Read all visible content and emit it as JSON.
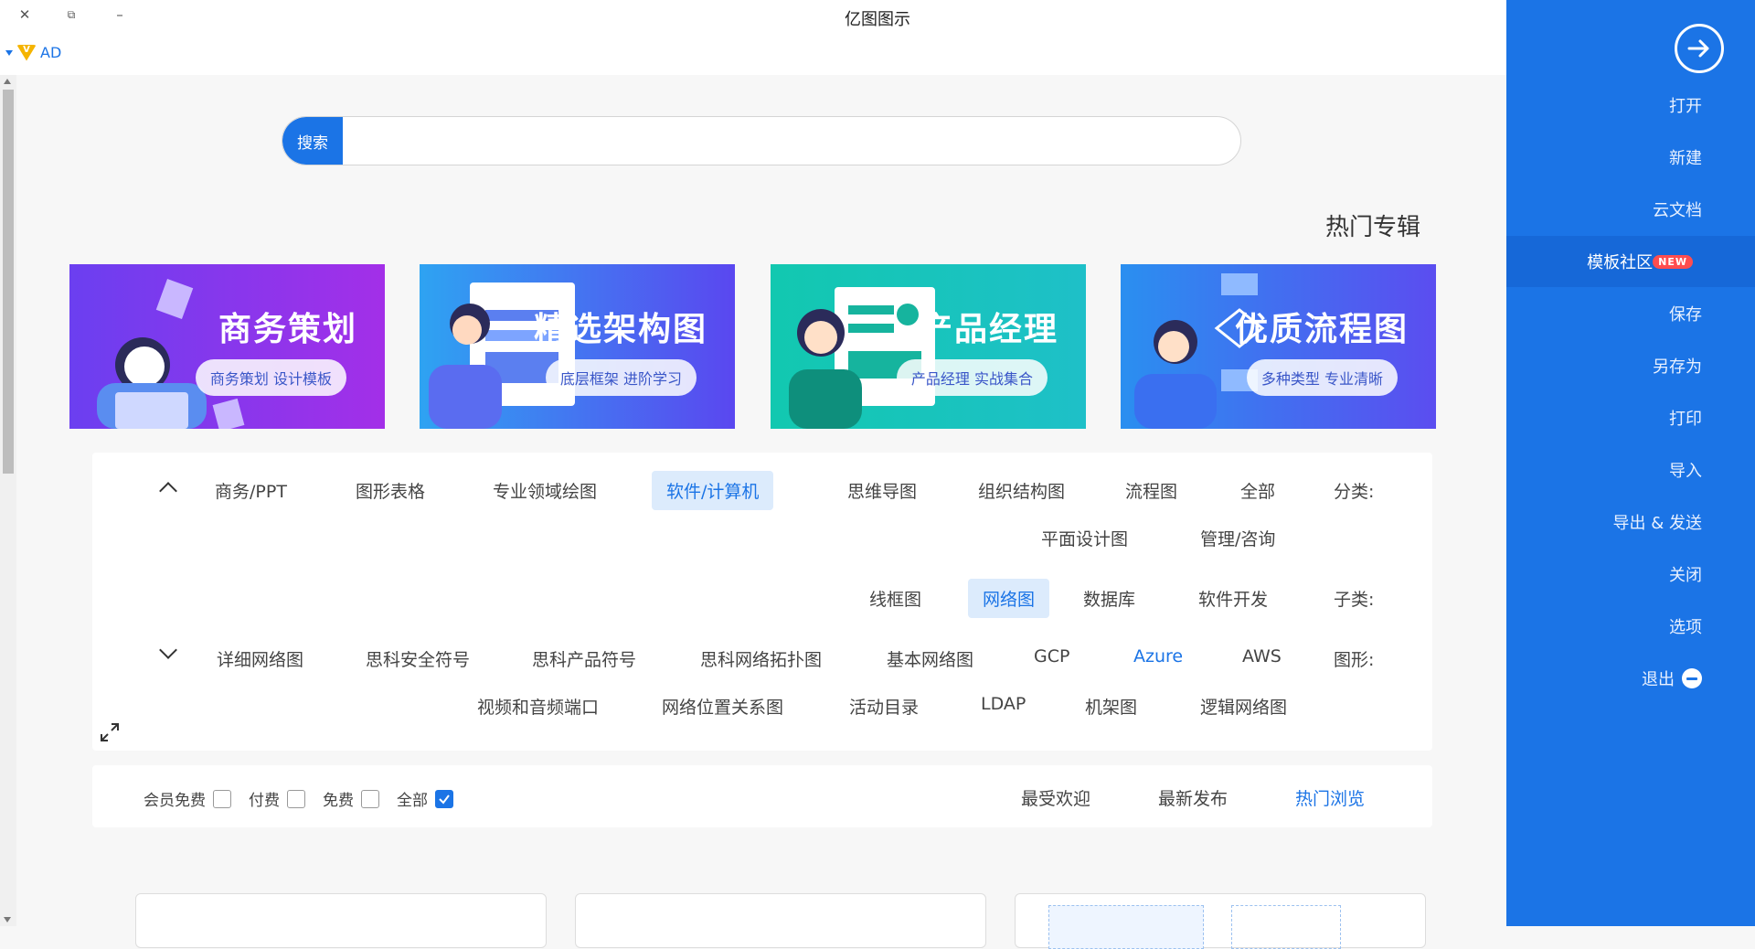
{
  "window": {
    "title": "亿图图示",
    "close_glyph": "✕",
    "restore_glyph": "⧉",
    "minimize_glyph": "–"
  },
  "ad": {
    "label": "AD",
    "vip_glyph": "V"
  },
  "sidebar": {
    "back_icon": "arrow-right-icon",
    "items": [
      {
        "label": "打开"
      },
      {
        "label": "新建"
      },
      {
        "label": "云文档"
      },
      {
        "label": "模板社区",
        "badge": "NEW",
        "active": true
      },
      {
        "label": "保存"
      },
      {
        "label": "另存为"
      },
      {
        "label": "打印"
      },
      {
        "label": "导入"
      },
      {
        "label": "导出 & 发送"
      },
      {
        "label": "关闭"
      },
      {
        "label": "选项"
      },
      {
        "label": "退出"
      }
    ]
  },
  "search": {
    "button_label": "搜索",
    "value": "",
    "placeholder": ""
  },
  "hot": {
    "title": "热门专辑",
    "banners": [
      {
        "title": "商务策划",
        "subtitle": "商务策划 设计模板",
        "color_a": "#6b3ff0",
        "color_b": "#a32fe8"
      },
      {
        "title": "精选架构图",
        "subtitle": "底层框架 进阶学习",
        "color_a": "#2ea3f2",
        "color_b": "#5a47f0"
      },
      {
        "title": "产品经理",
        "subtitle": "产品经理 实战集合",
        "color_a": "#12c8b0",
        "color_b": "#1ec0c8"
      },
      {
        "title": "优质流程图",
        "subtitle": "多种类型 专业清晰",
        "color_a": "#2a8ff0",
        "color_b": "#5b4df0"
      }
    ]
  },
  "filter": {
    "category_label": "分类:",
    "categories": [
      "全部",
      "流程图",
      "组织结构图",
      "思维导图",
      "软件/计算机",
      "专业领域绘图",
      "图形表格",
      "商务/PPT",
      "管理/咨询",
      "平面设计图"
    ],
    "subcategory_label": "子类:",
    "subcategories": [
      "软件开发",
      "数据库",
      "网络图",
      "线框图"
    ],
    "shape_label": "图形:",
    "shapes": [
      "AWS",
      "Azure",
      "GCP",
      "基本网络图",
      "思科网络拓扑图",
      "思科产品符号",
      "思科安全符号",
      "详细网络图",
      "逻辑网络图",
      "机架图",
      "LDAP",
      "活动目录",
      "网络位置关系图",
      "视频和音频端口"
    ]
  },
  "sort": {
    "tabs": [
      "热门浏览",
      "最新发布",
      "最受欢迎"
    ],
    "checks": [
      {
        "label": "全部",
        "checked": true
      },
      {
        "label": "免费",
        "checked": false
      },
      {
        "label": "付费",
        "checked": false
      },
      {
        "label": "会员免费",
        "checked": false
      }
    ]
  },
  "colors": {
    "accent": "#1b74e6",
    "sidebar_active": "#1668d8",
    "badge": "#ff4d4f"
  }
}
